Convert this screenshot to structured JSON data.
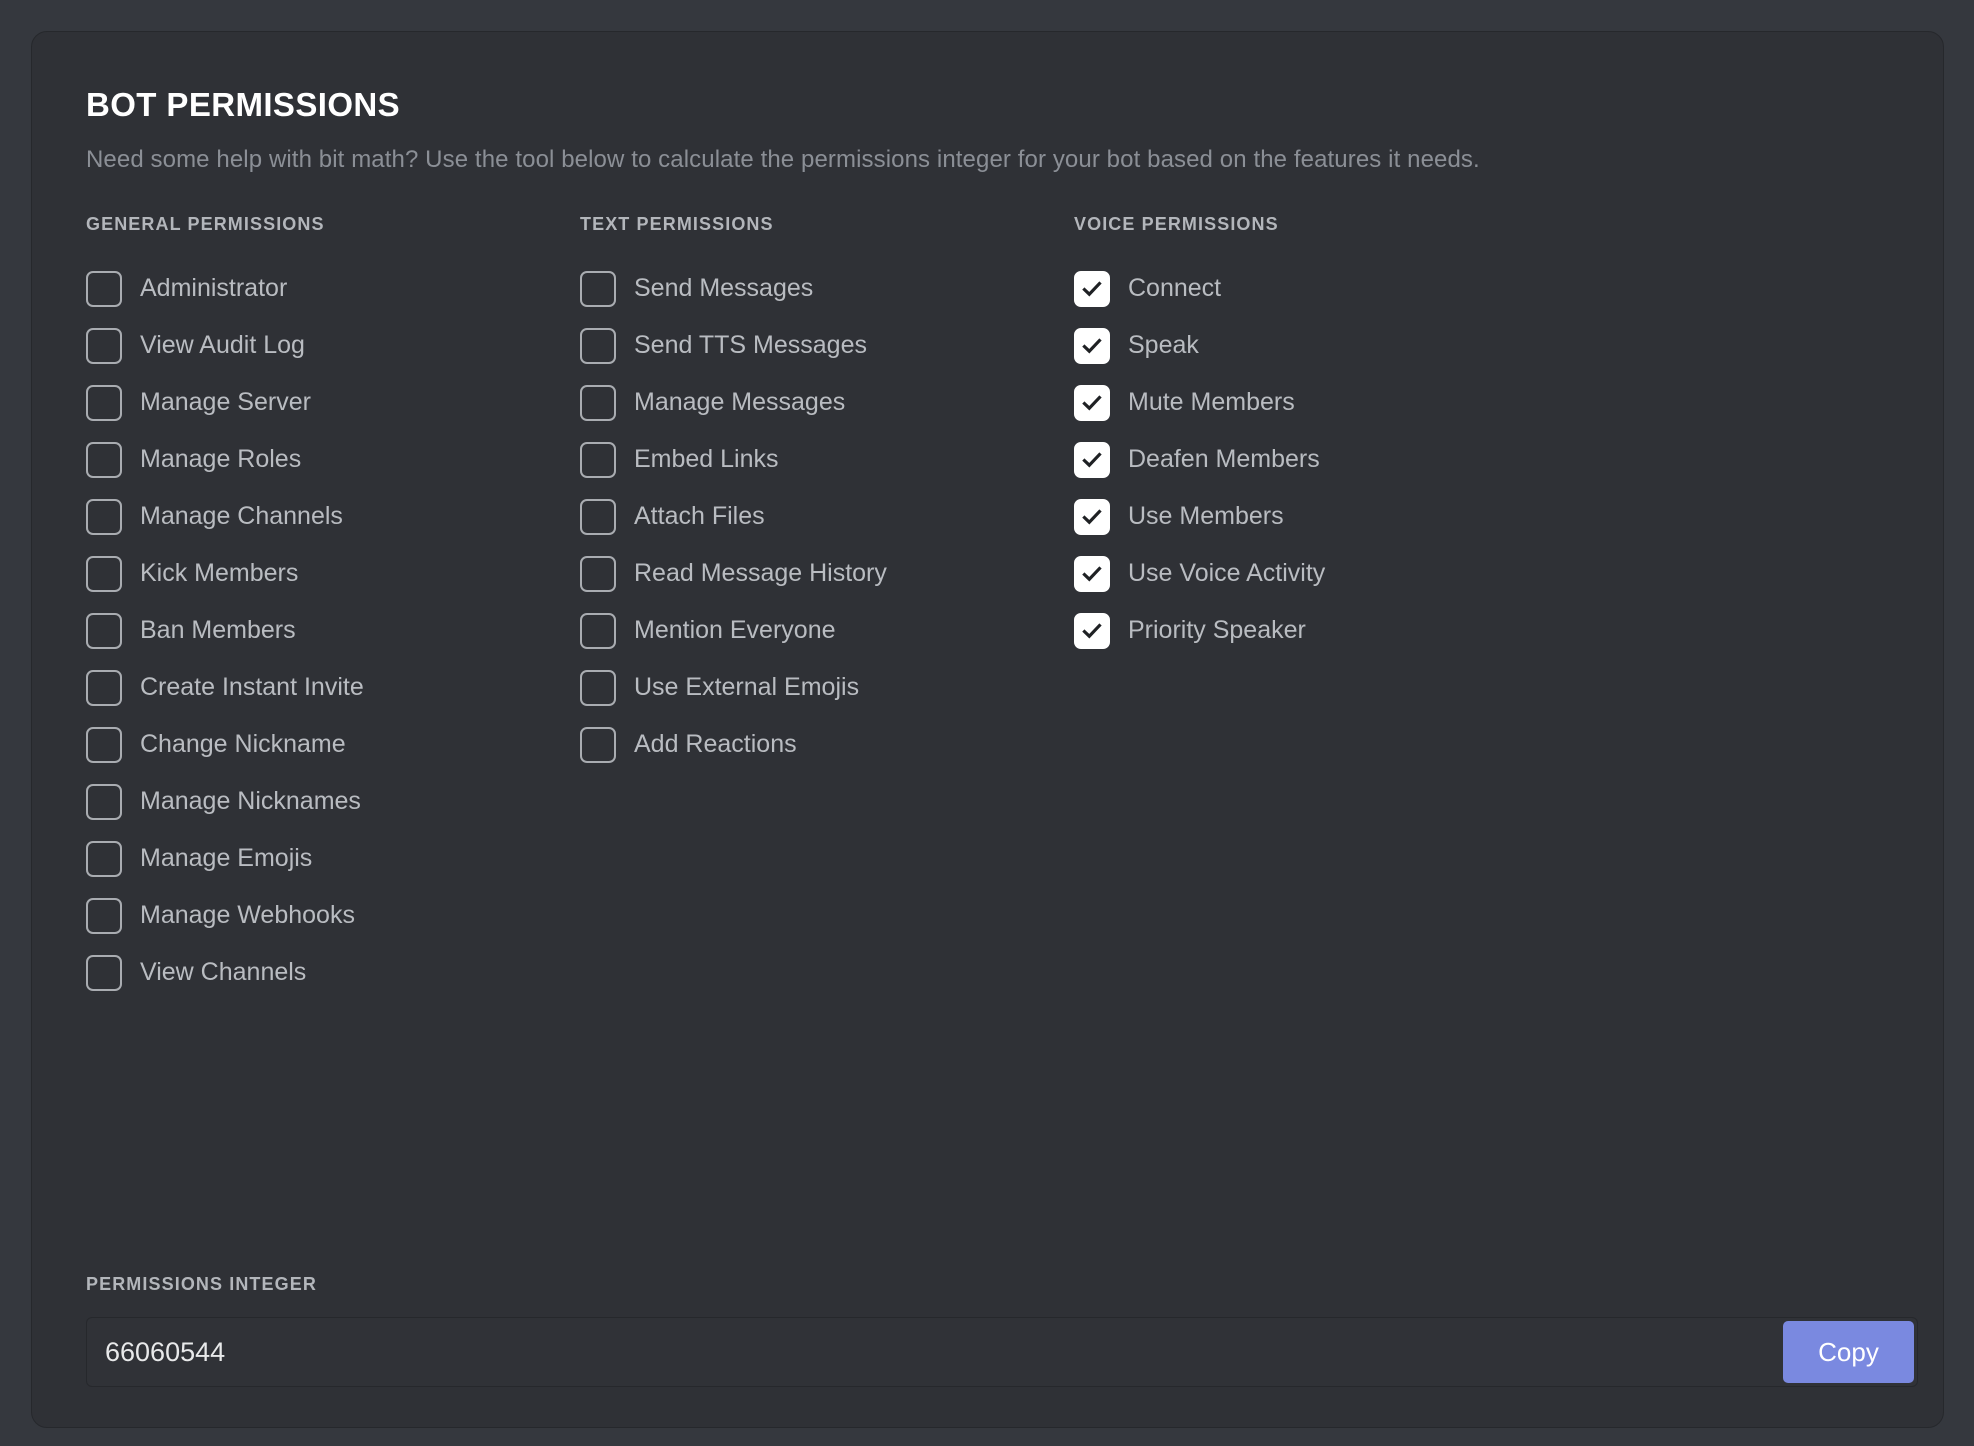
{
  "card": {
    "title": "BOT PERMISSIONS",
    "subtitle": "Need some help with bit math? Use the tool below to calculate the permissions integer for your bot based on the features it needs."
  },
  "columns": {
    "general": {
      "header": "GENERAL PERMISSIONS",
      "items": [
        {
          "label": "Administrator",
          "checked": false
        },
        {
          "label": "View Audit Log",
          "checked": false
        },
        {
          "label": "Manage Server",
          "checked": false
        },
        {
          "label": "Manage Roles",
          "checked": false
        },
        {
          "label": "Manage Channels",
          "checked": false
        },
        {
          "label": "Kick Members",
          "checked": false
        },
        {
          "label": "Ban Members",
          "checked": false
        },
        {
          "label": "Create Instant Invite",
          "checked": false
        },
        {
          "label": "Change Nickname",
          "checked": false
        },
        {
          "label": "Manage Nicknames",
          "checked": false
        },
        {
          "label": "Manage Emojis",
          "checked": false
        },
        {
          "label": "Manage Webhooks",
          "checked": false
        },
        {
          "label": "View Channels",
          "checked": false
        }
      ]
    },
    "text": {
      "header": "TEXT PERMISSIONS",
      "items": [
        {
          "label": "Send Messages",
          "checked": false
        },
        {
          "label": "Send TTS Messages",
          "checked": false
        },
        {
          "label": "Manage Messages",
          "checked": false
        },
        {
          "label": "Embed Links",
          "checked": false
        },
        {
          "label": "Attach Files",
          "checked": false
        },
        {
          "label": "Read Message History",
          "checked": false
        },
        {
          "label": "Mention Everyone",
          "checked": false
        },
        {
          "label": "Use External Emojis",
          "checked": false
        },
        {
          "label": "Add Reactions",
          "checked": false
        }
      ]
    },
    "voice": {
      "header": "VOICE PERMISSIONS",
      "items": [
        {
          "label": "Connect",
          "checked": true
        },
        {
          "label": "Speak",
          "checked": true
        },
        {
          "label": "Mute Members",
          "checked": true
        },
        {
          "label": "Deafen Members",
          "checked": true
        },
        {
          "label": "Use Members",
          "checked": true
        },
        {
          "label": "Use Voice Activity",
          "checked": true
        },
        {
          "label": "Priority Speaker",
          "checked": true
        }
      ]
    }
  },
  "integer_section": {
    "header": "PERMISSIONS INTEGER",
    "value": "66060544",
    "copy_label": "Copy"
  },
  "colors": {
    "page_background": "#35383e",
    "card_background": "#2f3136",
    "accent_copy_button": "#7a89e0",
    "checkbox_checked_fill": "#ffffff",
    "checkbox_checkmark": "#1f2124",
    "label_text": "#b9bcc1",
    "header_text": "#b3b6bb",
    "title_text": "#ffffff",
    "subtitle_text": "#8b8f96"
  }
}
